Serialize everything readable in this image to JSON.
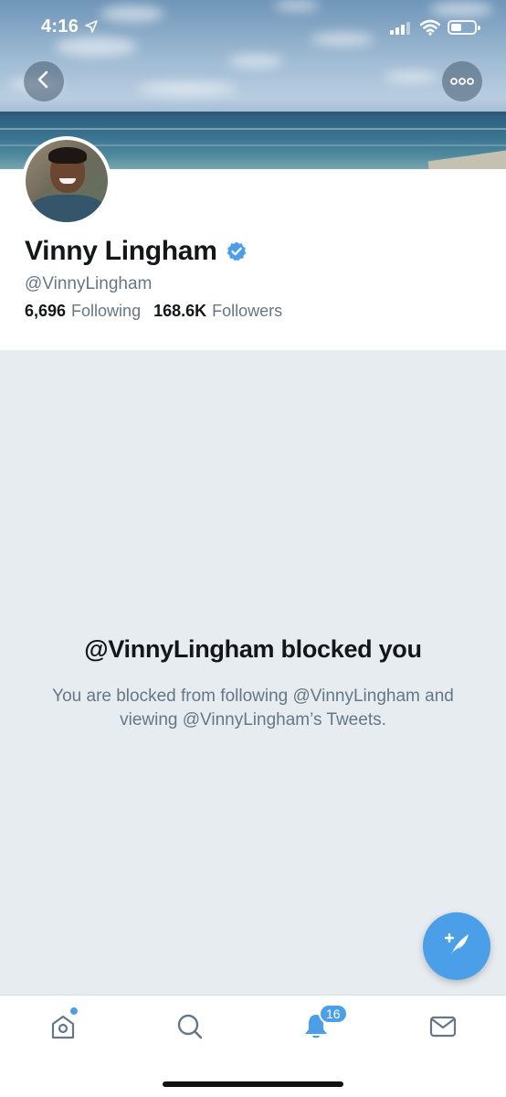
{
  "status_bar": {
    "time": "4:16",
    "icons": [
      "location-arrow-icon",
      "signal-icon",
      "wifi-icon",
      "battery-icon"
    ]
  },
  "header": {
    "back_icon": "chevron-left-icon",
    "more_icon": "ellipsis-icon"
  },
  "profile": {
    "display_name": "Vinny Lingham",
    "verified": true,
    "handle": "@VinnyLingham",
    "following_count": "6,696",
    "following_label": "Following",
    "followers_count": "168.6K",
    "followers_label": "Followers"
  },
  "blocked": {
    "title": "@VinnyLingham blocked you",
    "description": "You are blocked from following @VinnyLingham and viewing @VinnyLingham’s Tweets."
  },
  "compose": {
    "icon": "compose-tweet-icon"
  },
  "tabbar": {
    "items": [
      {
        "name": "home",
        "icon": "home-icon",
        "has_dot": true
      },
      {
        "name": "search",
        "icon": "search-icon"
      },
      {
        "name": "notifications",
        "icon": "bell-icon",
        "badge": "16"
      },
      {
        "name": "messages",
        "icon": "mail-icon"
      }
    ]
  },
  "colors": {
    "accent": "#4a9fe8",
    "blocked_bg": "#e6ecf0",
    "secondary_text": "#657786",
    "primary_text": "#14171a"
  }
}
